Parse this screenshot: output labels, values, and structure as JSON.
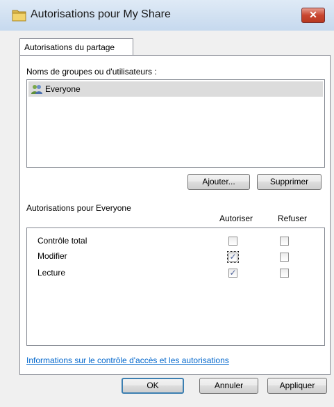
{
  "window": {
    "title": "Autorisations pour My Share",
    "close_glyph": "✕",
    "icon": "folder-icon"
  },
  "tab": {
    "label": "Autorisations du partage"
  },
  "groups": {
    "label": "Noms de groupes ou d'utilisateurs :",
    "items": [
      {
        "name": "Everyone",
        "icon": "users-icon",
        "selected": true
      }
    ]
  },
  "buttons": {
    "add": "Ajouter...",
    "remove": "Supprimer",
    "ok": "OK",
    "cancel": "Annuler",
    "apply": "Appliquer"
  },
  "permissions": {
    "label": "Autorisations pour Everyone",
    "col_allow": "Autoriser",
    "col_deny": "Refuser",
    "rows": [
      {
        "name": "Contrôle total",
        "allow": false,
        "deny": false
      },
      {
        "name": "Modifier",
        "allow": true,
        "deny": false
      },
      {
        "name": "Lecture",
        "allow": true,
        "deny": false
      }
    ],
    "check_glyph": "✓"
  },
  "link": {
    "text": "Informations sur le contrôle d'accès et les autorisations"
  },
  "colors": {
    "link": "#0066cc",
    "close_button": "#c9452f",
    "selection": "#dcdcdc"
  }
}
